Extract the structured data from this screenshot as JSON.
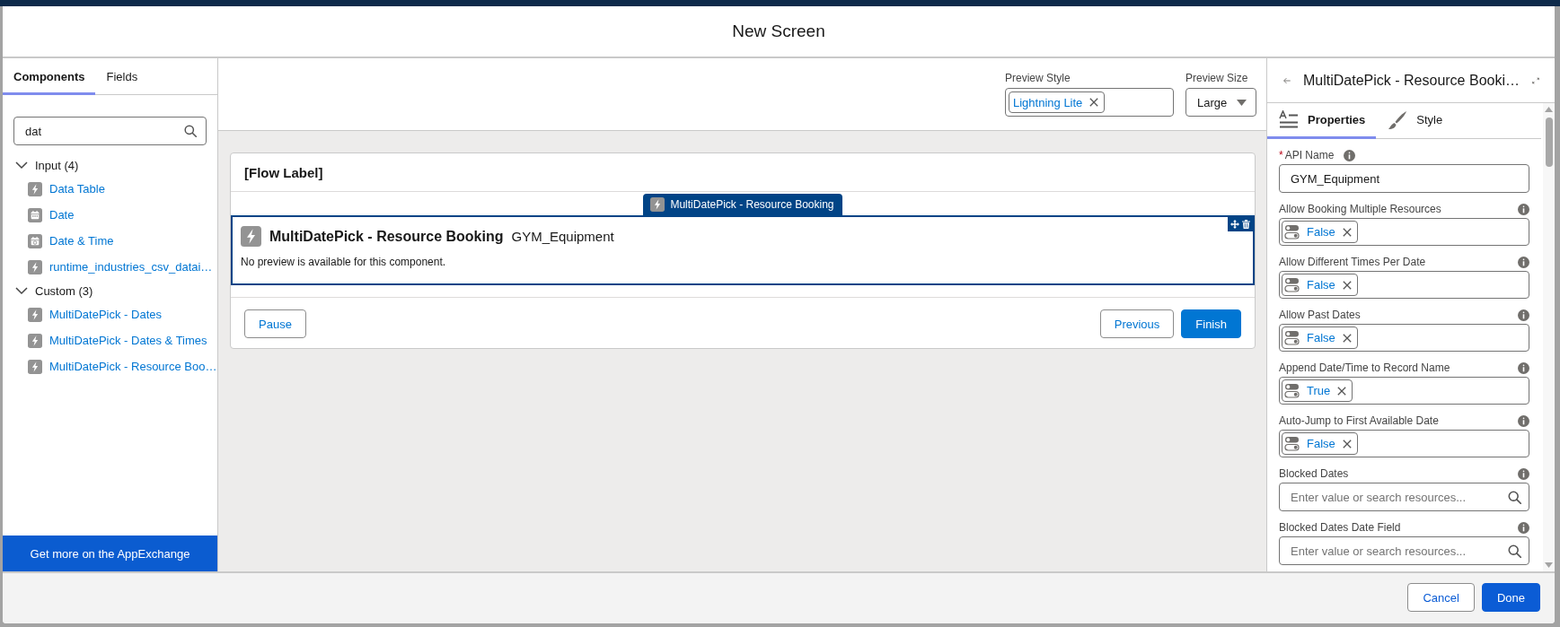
{
  "modal": {
    "title": "New Screen"
  },
  "left_panel": {
    "tabs": [
      {
        "label": "Components",
        "selected": true
      },
      {
        "label": "Fields",
        "selected": false
      }
    ],
    "search": {
      "value": "dat"
    },
    "groups": [
      {
        "label": "Input (4)",
        "expanded": true,
        "items": [
          {
            "kind": "lightning",
            "label": "Data Table"
          },
          {
            "kind": "date",
            "label": "Date"
          },
          {
            "kind": "datetime",
            "label": "Date & Time"
          },
          {
            "kind": "lightning",
            "label": "runtime_industries_csv_datai…"
          }
        ]
      },
      {
        "label": "Custom (3)",
        "expanded": true,
        "items": [
          {
            "kind": "lightning",
            "label": "MultiDatePick - Dates"
          },
          {
            "kind": "lightning",
            "label": "MultiDatePick - Dates & Times"
          },
          {
            "kind": "lightning",
            "label": "MultiDatePick - Resource Boo…"
          }
        ]
      }
    ],
    "appexchange_link": "Get more on the AppExchange"
  },
  "preview_toolbar": {
    "style": {
      "label": "Preview Style",
      "tokens": [
        "Lightning Lite"
      ]
    },
    "size": {
      "label": "Preview Size",
      "value": "Large"
    }
  },
  "canvas": {
    "flow_label": "[Flow Label]",
    "component": {
      "selected": true,
      "tab_label": "MultiDatePick - Resource Booking",
      "title": "MultiDatePick - Resource Booking",
      "api_name": "GYM_Equipment",
      "message": "No preview is available for this component."
    },
    "buttons_left": [
      {
        "label": "Pause",
        "kind": "neutral"
      }
    ],
    "buttons_right": [
      {
        "label": "Previous",
        "kind": "neutral"
      },
      {
        "label": "Finish",
        "kind": "brand"
      }
    ]
  },
  "properties_panel": {
    "title": "MultiDatePick - Resource Booki…",
    "tabs": [
      {
        "label": "Properties",
        "kind": "properties",
        "selected": true
      },
      {
        "label": "Style",
        "kind": "style",
        "selected": false
      }
    ],
    "fields": [
      {
        "kind": "text",
        "label": "API Name",
        "required_mark": "*",
        "value": "GYM_Equipment"
      },
      {
        "kind": "boolean",
        "label": "Allow Booking Multiple Resources",
        "value": "False"
      },
      {
        "kind": "boolean",
        "label": "Allow Different Times Per Date",
        "value": "False"
      },
      {
        "kind": "boolean",
        "label": "Allow Past Dates",
        "value": "False"
      },
      {
        "kind": "boolean",
        "label": "Append Date/Time to Record Name",
        "value": "True"
      },
      {
        "kind": "boolean",
        "label": "Auto-Jump to First Available Date",
        "value": "False"
      },
      {
        "kind": "lookup",
        "label": "Blocked Dates",
        "placeholder": "Enter value or search resources..."
      },
      {
        "kind": "lookup",
        "label": "Blocked Dates Date Field",
        "placeholder": "Enter value or search resources..."
      }
    ]
  },
  "footer": {
    "buttons": [
      {
        "label": "Cancel",
        "kind": "neutral"
      },
      {
        "label": "Done",
        "kind": "brand"
      }
    ]
  }
}
